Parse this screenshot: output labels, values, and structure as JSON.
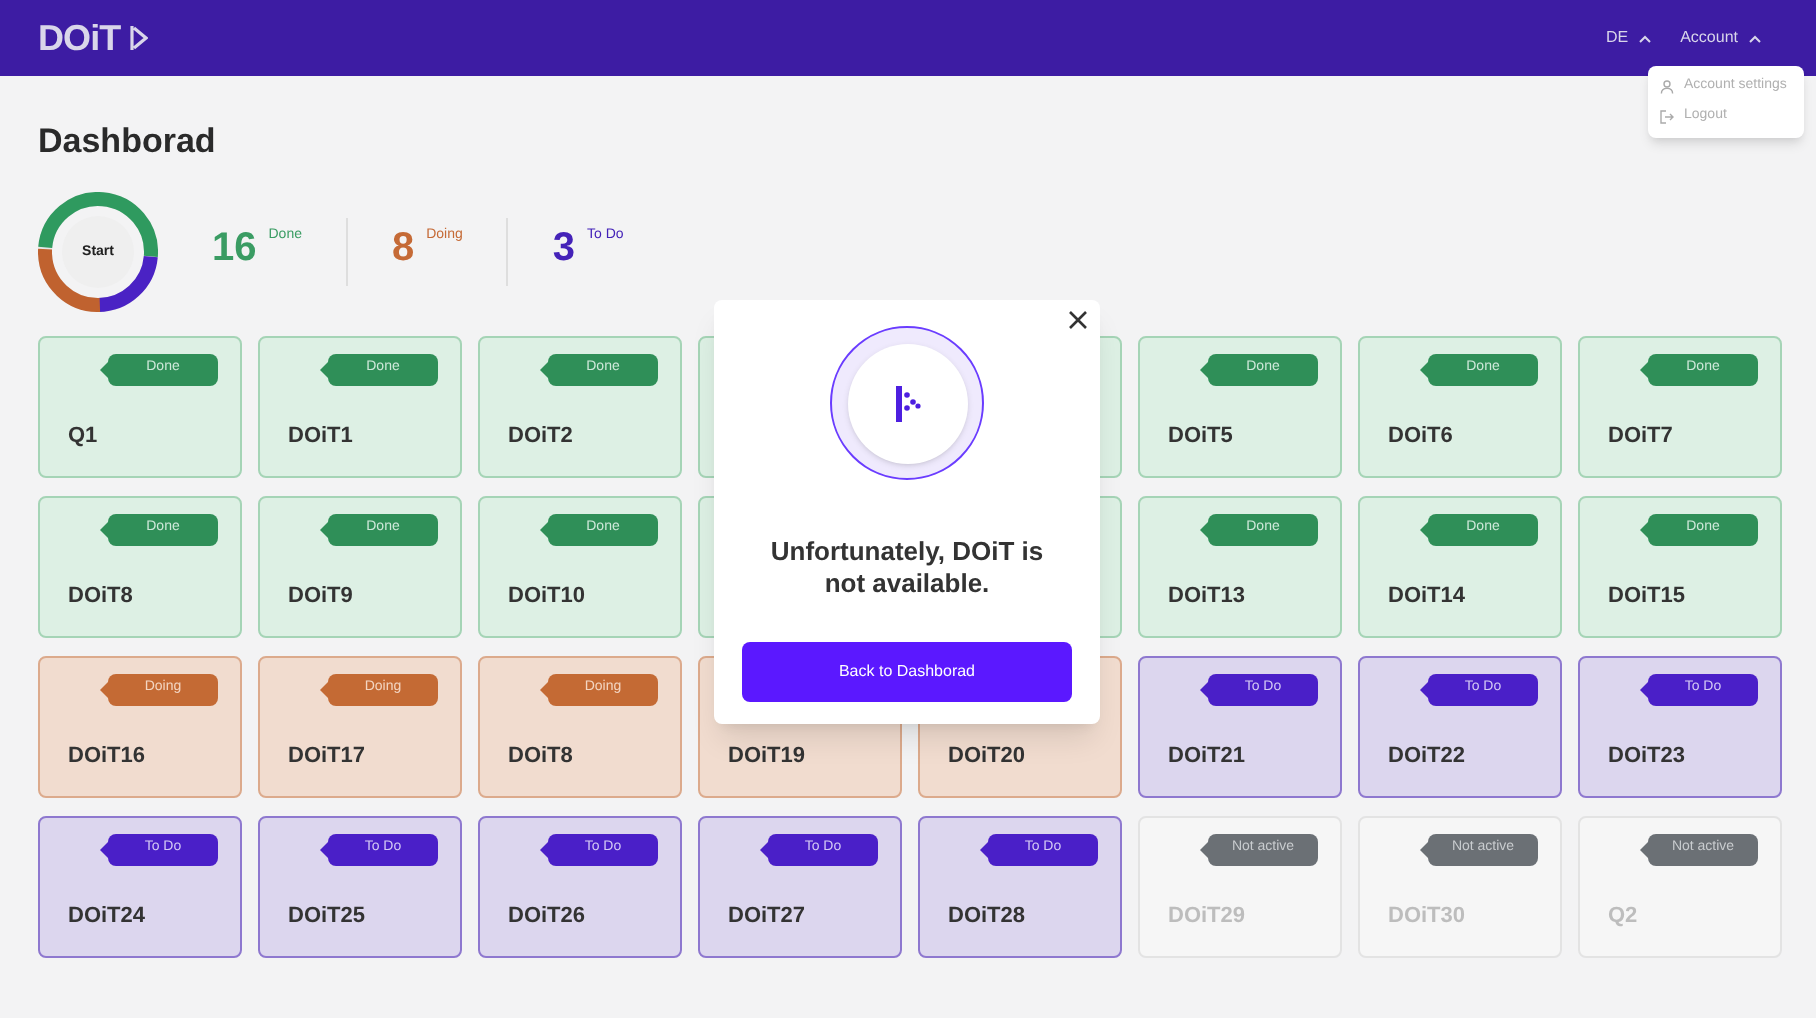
{
  "header": {
    "logo": "DOiT",
    "language": "DE",
    "account": "Account"
  },
  "account_menu": [
    {
      "label": "Account settings",
      "kind": "settings"
    },
    {
      "label": "Logout",
      "kind": "logout"
    }
  ],
  "page_title": "Dashborad",
  "donut": {
    "center_label": "Start"
  },
  "stats": [
    {
      "count": "16",
      "label": "Done",
      "kind": "done"
    },
    {
      "count": "8",
      "label": "Doing",
      "kind": "doing"
    },
    {
      "count": "3",
      "label": "To Do",
      "kind": "todo"
    }
  ],
  "tiles": [
    {
      "kind": "done",
      "name": "Q1",
      "badge": "Done"
    },
    {
      "kind": "done",
      "name": "DOiT1",
      "badge": "Done"
    },
    {
      "kind": "done",
      "name": "DOiT2",
      "badge": "Done"
    },
    {
      "kind": "done"
    },
    {
      "kind": "done"
    },
    {
      "kind": "done",
      "name": "DOiT5",
      "badge": "Done"
    },
    {
      "kind": "done",
      "name": "DOiT6",
      "badge": "Done"
    },
    {
      "kind": "done",
      "name": "DOiT7",
      "badge": "Done"
    },
    {
      "kind": "done",
      "name": "DOiT8",
      "badge": "Done"
    },
    {
      "kind": "done",
      "name": "DOiT9",
      "badge": "Done"
    },
    {
      "kind": "done",
      "name": "DOiT10",
      "badge": "Done"
    },
    {
      "kind": "done"
    },
    {
      "kind": "done"
    },
    {
      "kind": "done",
      "name": "DOiT13",
      "badge": "Done"
    },
    {
      "kind": "done",
      "name": "DOiT14",
      "badge": "Done"
    },
    {
      "kind": "done",
      "name": "DOiT15",
      "badge": "Done"
    },
    {
      "kind": "doing",
      "name": "DOiT16",
      "badge": "Doing"
    },
    {
      "kind": "doing",
      "name": "DOiT17",
      "badge": "Doing"
    },
    {
      "kind": "doing",
      "name": "DOiT8",
      "badge": "Doing"
    },
    {
      "kind": "doing",
      "name": "DOiT19"
    },
    {
      "kind": "doing",
      "name": "DOiT20"
    },
    {
      "kind": "todo",
      "name": "DOiT21",
      "badge": "To Do"
    },
    {
      "kind": "todo",
      "name": "DOiT22",
      "badge": "To Do"
    },
    {
      "kind": "todo",
      "name": "DOiT23",
      "badge": "To Do"
    },
    {
      "kind": "todo",
      "name": "DOiT24",
      "badge": "To Do"
    },
    {
      "kind": "todo",
      "name": "DOiT25",
      "badge": "To Do"
    },
    {
      "kind": "todo",
      "name": "DOiT26",
      "badge": "To Do"
    },
    {
      "kind": "todo",
      "name": "DOiT27",
      "badge": "To Do"
    },
    {
      "kind": "todo",
      "name": "DOiT28",
      "badge": "To Do"
    },
    {
      "kind": "inactive",
      "name": "DOiT29",
      "badge": "Not active"
    },
    {
      "kind": "inactive",
      "name": "DOiT30",
      "badge": "Not active"
    },
    {
      "kind": "inactive",
      "name": "Q2",
      "badge": "Not active"
    }
  ],
  "dialog": {
    "message": "Unfortunately, DOiT is not available.",
    "button": "Back to Dashborad"
  }
}
